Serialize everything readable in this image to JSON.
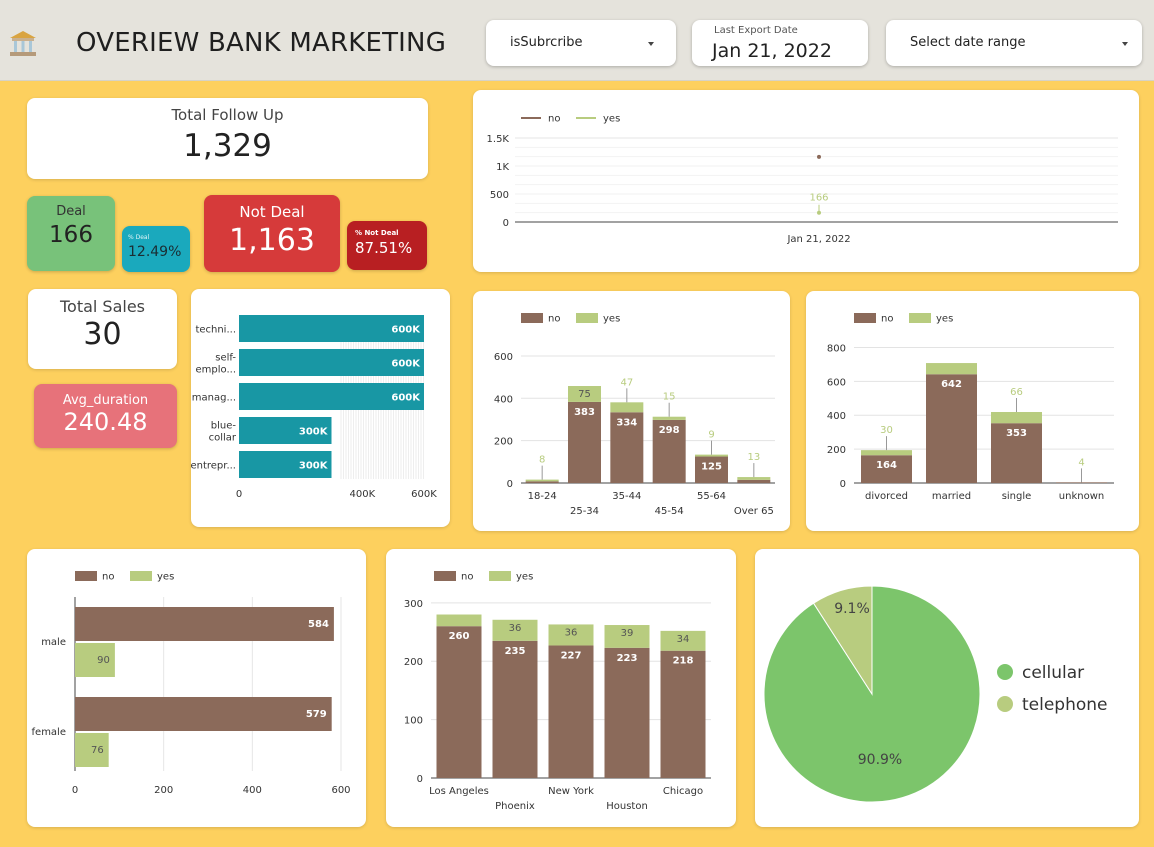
{
  "header": {
    "title": "OVERIEW BANK MARKETING",
    "logo_icon": "bank-icon"
  },
  "controls": {
    "subscribe_label": "isSubrcribe",
    "export_caption": "Last Export Date",
    "export_date": "Jan 21, 2022",
    "date_range_label": "Select date range"
  },
  "kpi": {
    "total_follow_up_label": "Total Follow Up",
    "total_follow_up_value": "1,329",
    "deal_label": "Deal",
    "deal_value": "166",
    "pct_deal_label": "% Deal",
    "pct_deal_value": "12.49%",
    "not_deal_label": "Not Deal",
    "not_deal_value": "1,163",
    "pct_not_deal_label": "% Not Deal",
    "pct_not_deal_value": "87.51%",
    "total_sales_label": "Total Sales",
    "total_sales_value": "30",
    "avg_duration_label": "Avg_duration",
    "avg_duration_value": "240.48"
  },
  "colors": {
    "no": "#8b6a5a",
    "yes": "#b8cc7f",
    "teal": "#1897a4",
    "deal_green": "#78c27a",
    "not_deal_red": "#d63a3a",
    "avg_pink": "#e7727a",
    "cellular": "#7cc56b",
    "telephone": "#b8cc7f"
  },
  "chart_data": [
    {
      "id": "timeline",
      "type": "line",
      "legend": [
        "no",
        "yes"
      ],
      "x": [
        "Jan 21, 2022"
      ],
      "series": [
        {
          "name": "no",
          "values": [
            1163
          ]
        },
        {
          "name": "yes",
          "values": [
            166
          ]
        }
      ],
      "data_labels": [
        "166"
      ],
      "yticks": [
        "0",
        "500",
        "1K",
        "1.5K"
      ],
      "ylim": [
        0,
        1500
      ]
    },
    {
      "id": "job",
      "type": "bar",
      "orientation": "horizontal",
      "categories": [
        "techni...",
        "self-emplo...",
        "manag...",
        "blue-collar",
        "entrepr..."
      ],
      "category_lines": [
        [
          "techni..."
        ],
        [
          "self-",
          "emplo..."
        ],
        [
          "manag..."
        ],
        [
          "blue-",
          "collar"
        ],
        [
          "entrepr..."
        ]
      ],
      "values": [
        600000,
        600000,
        600000,
        300000,
        300000
      ],
      "data_labels": [
        "600K",
        "600K",
        "600K",
        "300K",
        "300K"
      ],
      "xticks": [
        "0",
        "400K",
        "600K"
      ],
      "xtick_values": [
        0,
        400000,
        600000
      ],
      "xlim": [
        0,
        600000
      ]
    },
    {
      "id": "age",
      "type": "bar",
      "stacked": true,
      "legend": [
        "no",
        "yes"
      ],
      "categories": [
        "18-24",
        "25-34",
        "35-44",
        "45-54",
        "55-64",
        "Over 65"
      ],
      "series": [
        {
          "name": "no",
          "values": [
            8,
            383,
            334,
            298,
            125,
            15
          ],
          "labels": [
            "",
            "383",
            "334",
            "298",
            "125",
            "15"
          ]
        },
        {
          "name": "yes",
          "values": [
            8,
            75,
            47,
            15,
            9,
            13
          ],
          "labels": [
            "8",
            "75",
            "47",
            "15",
            "9",
            "13"
          ]
        }
      ],
      "yticks": [
        0,
        200,
        400,
        600
      ],
      "ylim": [
        0,
        680
      ]
    },
    {
      "id": "marital",
      "type": "bar",
      "stacked": true,
      "legend": [
        "no",
        "yes"
      ],
      "categories": [
        "divorced",
        "married",
        "single",
        "unknown"
      ],
      "series": [
        {
          "name": "no",
          "values": [
            164,
            642,
            353,
            4
          ],
          "labels": [
            "164",
            "642",
            "353",
            ""
          ]
        },
        {
          "name": "yes",
          "values": [
            30,
            66,
            66,
            0
          ],
          "labels": [
            "30",
            "",
            "66",
            "4"
          ]
        }
      ],
      "yticks": [
        0,
        200,
        400,
        600,
        800
      ],
      "ylim": [
        0,
        850
      ]
    },
    {
      "id": "gender",
      "type": "bar",
      "orientation": "horizontal",
      "legend": [
        "no",
        "yes"
      ],
      "categories": [
        "male",
        "female"
      ],
      "series": [
        {
          "name": "no",
          "values": [
            584,
            579
          ]
        },
        {
          "name": "yes",
          "values": [
            90,
            76
          ]
        }
      ],
      "xticks": [
        0,
        200,
        400,
        600
      ],
      "xlim": [
        0,
        600
      ]
    },
    {
      "id": "city",
      "type": "bar",
      "stacked": true,
      "legend": [
        "no",
        "yes"
      ],
      "categories": [
        "Los Angeles",
        "Phoenix",
        "New York",
        "Houston",
        "Chicago"
      ],
      "series": [
        {
          "name": "no",
          "values": [
            260,
            235,
            227,
            223,
            218
          ]
        },
        {
          "name": "yes",
          "values": [
            20,
            36,
            36,
            39,
            34
          ],
          "labels": [
            "",
            "36",
            "36",
            "39",
            "34"
          ]
        }
      ],
      "yticks": [
        0,
        100,
        200,
        300
      ],
      "ylim": [
        0,
        310
      ]
    },
    {
      "id": "contact",
      "type": "pie",
      "labels": [
        "cellular",
        "telephone"
      ],
      "values": [
        90.9,
        9.1
      ],
      "pct_labels": [
        "90.9%",
        "9.1%"
      ]
    }
  ]
}
